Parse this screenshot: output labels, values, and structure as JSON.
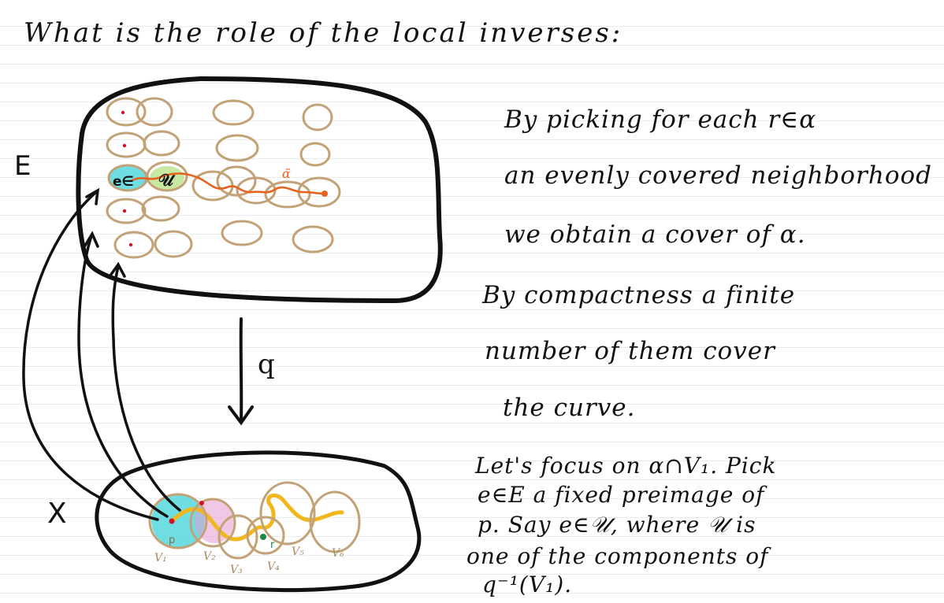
{
  "title": "What is the role of the local inverses:",
  "paragraph1": {
    "line1": "By picking for each r∈α",
    "line2": "an evenly covered neighborhood",
    "line3": "we obtain a cover of α."
  },
  "paragraph2": {
    "line1": "By compactness a finite",
    "line2": "number of them cover",
    "line3": "the curve."
  },
  "paragraph3": {
    "line1": "Let's focus on α∩V₁. Pick",
    "line2": "e∈E a fixed preimage of",
    "line3": "p. Say e∈𝒰, where 𝒰 is",
    "line4": "one of the components of",
    "line5": "q⁻¹(V₁)."
  },
  "diagram": {
    "space_E_label": "E",
    "space_X_label": "X",
    "map_label": "q",
    "point_e_label": "e∈",
    "component_label": "𝒰",
    "lifted_curve_label": "α̃",
    "point_p_label": "p",
    "point_r_label": "r",
    "neighborhood_labels": [
      "V₁",
      "V₂",
      "V₃",
      "V₄",
      "V₅",
      "V₆"
    ],
    "colors": {
      "ink": "#111111",
      "neighborhood": "#c2a276",
      "curve_base": "#f2b71c",
      "curve_lift": "#e8621f",
      "highlight_cyan": "#3fd3d8",
      "highlight_pink": "#e49ad2",
      "highlight_green": "#b9e38a",
      "dot_red": "#d2122a",
      "dot_green": "#188a3c"
    }
  }
}
